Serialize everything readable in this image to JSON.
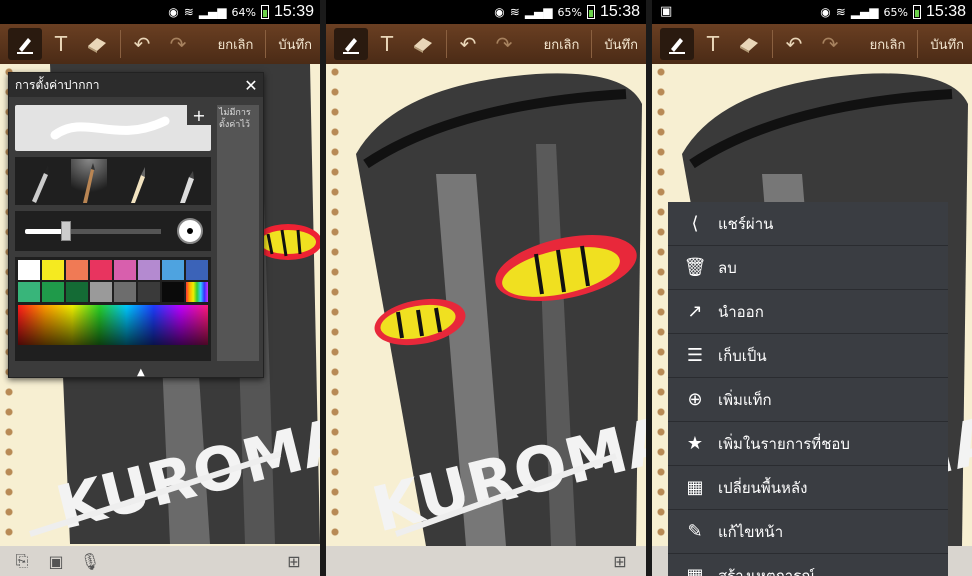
{
  "status_bars": [
    {
      "battery": "64%",
      "time": "15:39"
    },
    {
      "battery": "65%",
      "time": "15:38"
    },
    {
      "battery": "65%",
      "time": "15:38"
    }
  ],
  "toolbar": {
    "cancel_label": "ยกเลิก",
    "save_label": "บันทึก",
    "text_icon": "T"
  },
  "pen_settings": {
    "title": "การตั้งค่าปากกา",
    "no_preset_label": "ไม่มีการตั้งค่าไว้",
    "swatches": [
      "#ffffff",
      "#f5ea20",
      "#f07a55",
      "#e8345f",
      "#d85fad",
      "#b48ad0",
      "#4ea3e0",
      "#3b63b8",
      "#38b57a",
      "#1f9a4a",
      "#146b35",
      "#9a9a9a",
      "#6d6d6d",
      "#3a3a3a",
      "#0a0a0a",
      "rainbow"
    ],
    "pen_size_percent": 30
  },
  "artwork": {
    "text": "KUROMATY"
  },
  "menu": {
    "items": [
      {
        "icon": "share-icon",
        "label": "แชร์ผ่าน"
      },
      {
        "icon": "trash-icon",
        "label": "ลบ"
      },
      {
        "icon": "export-icon",
        "label": "นำออก"
      },
      {
        "icon": "save-as-icon",
        "label": "เก็บเป็น"
      },
      {
        "icon": "add-tag-icon",
        "label": "เพิ่มแท็ก"
      },
      {
        "icon": "star-icon",
        "label": "เพิ่มในรายการที่ชอบ"
      },
      {
        "icon": "background-icon",
        "label": "เปลี่ยนพื้นหลัง"
      },
      {
        "icon": "edit-icon",
        "label": "แก้ไขหน้า"
      },
      {
        "icon": "calendar-icon",
        "label": "สร้างเหตุการณ์"
      }
    ]
  },
  "colors": {
    "toolbar_brown": "#5a3520",
    "paper": "#f7efd2",
    "menu_bg": "#3a3d42"
  }
}
